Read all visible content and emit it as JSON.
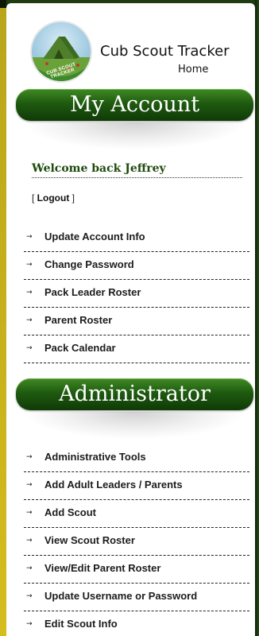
{
  "header": {
    "logo_ring_text": "CUB SCOUT TRACKER",
    "site_title": "Cub Scout Tracker",
    "home_link": "Home"
  },
  "my_account": {
    "title": "My Account",
    "welcome": "Welcome back Jeffrey",
    "logout_prefix": "[ ",
    "logout_label": "Logout",
    "logout_suffix": " ]",
    "items": [
      {
        "label": "Update Account Info"
      },
      {
        "label": "Change Password"
      },
      {
        "label": "Pack Leader Roster"
      },
      {
        "label": "Parent Roster"
      },
      {
        "label": "Pack Calendar"
      }
    ]
  },
  "administrator": {
    "title": "Administrator",
    "items": [
      {
        "label": "Administrative Tools"
      },
      {
        "label": "Add Adult Leaders / Parents"
      },
      {
        "label": "Add Scout"
      },
      {
        "label": "View Scout Roster"
      },
      {
        "label": "View/Edit Parent Roster"
      },
      {
        "label": "Update Username or Password"
      },
      {
        "label": "Edit Scout Info"
      }
    ]
  },
  "arrow_glyph": "→",
  "colors": {
    "section_bar": "#1f5a10",
    "frame_gold": "#d4bd1d",
    "welcome_text": "#1e4a0e"
  }
}
